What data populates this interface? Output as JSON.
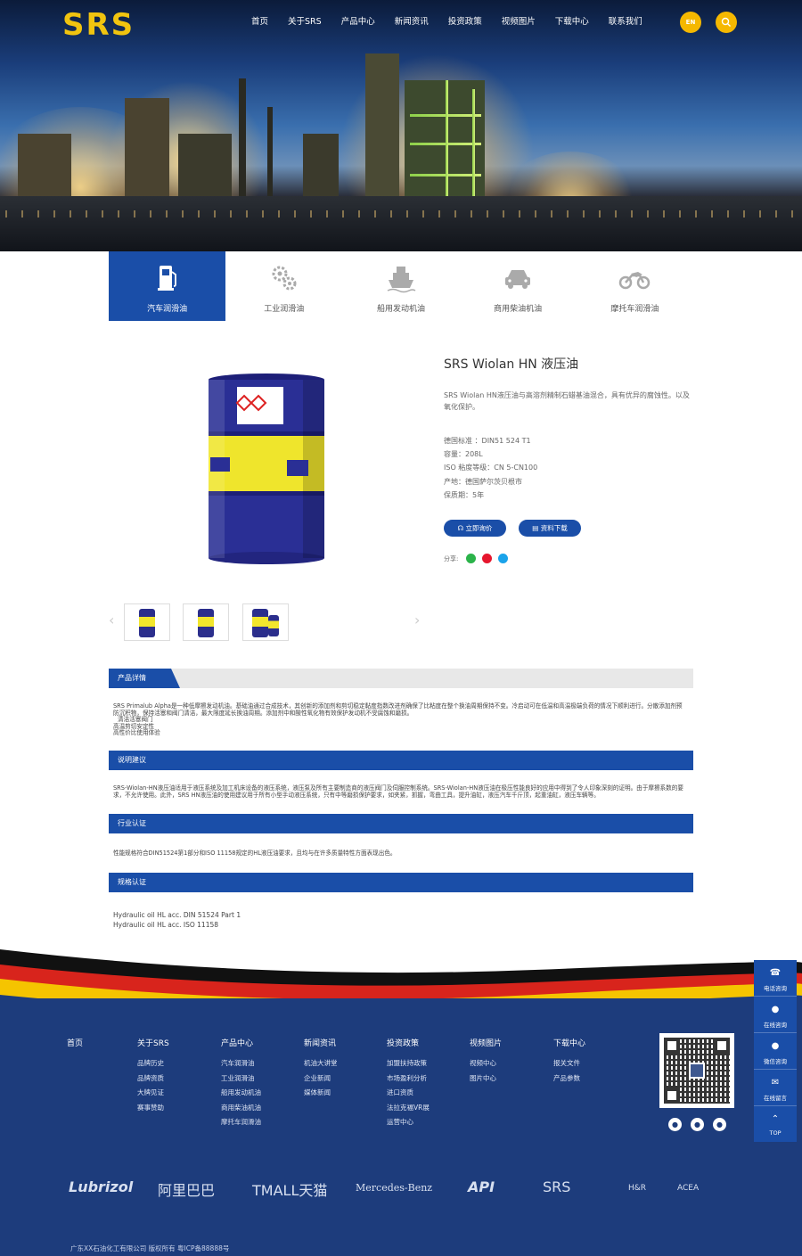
{
  "header": {
    "logo": "SRS",
    "nav": [
      "首页",
      "关于SRS",
      "产品中心",
      "新闻资讯",
      "投资政策",
      "视频图片",
      "下载中心",
      "联系我们"
    ],
    "lang_button": "EN",
    "search_icon": "search-icon"
  },
  "categories": [
    {
      "label": "汽车润滑油",
      "icon": "fuel-pump-icon",
      "active": true
    },
    {
      "label": "工业润滑油",
      "icon": "gears-icon",
      "active": false
    },
    {
      "label": "船用发动机油",
      "icon": "ship-icon",
      "active": false
    },
    {
      "label": "商用柴油机油",
      "icon": "car-icon",
      "active": false
    },
    {
      "label": "摩托车润滑油",
      "icon": "motorcycle-icon",
      "active": false
    }
  ],
  "product": {
    "title": "SRS Wiolan HN 液压油",
    "description": "SRS Wiolan HN液压油与高溶剂精制石蜡基油混合，具有优异的腐蚀性。以及氧化保护。",
    "specs": [
      "德国标准 ：DIN51 524 T1",
      "容量：208L",
      "ISO 粘度等级：CN 5-CN100",
      "产地：德国萨尔茨贝根市",
      "保质期：5年"
    ],
    "btn_inquiry": "立即询价",
    "btn_download": "资料下载",
    "share_label": "分享:"
  },
  "sections": {
    "detail": {
      "title": "产品详情",
      "lines": [
        "SRS Primalub Alpha是一种低摩擦发动机油。基础油通过合成技术，其创新的添加剂和剪切稳定黏度指数改进剂确保了比粘度在整个换油周期保持不变。冷启动可在低温和高温极端负荷的情况下顺利进行。分散添加剂预防沉积物，保持活塞和阀门清洁，最大限度延长换油周期。添加剂中和酸性氧化物有效保护发动机不受腐蚀和磨损。",
        "清洁活塞阀门",
        "高温剪切安定性",
        "高性价比使用体验"
      ]
    },
    "usage": {
      "title": "说明建议",
      "text": "SRS-Wiolan-HN液压油适用于液压系统及加工机床设备的液压系统，液压泵及所有主要制造商的液压阀门及伺服控制系统。SRS-Wiolan-HN液压油在极压性能良好的应用中得到了令人印象深刻的证明。由于摩擦系数的要求，不允许使用。此外，SRS HN液压油的使用建议用于所有小型手动液压系统，只有中等磨损保护要求，如夹紧，抓握，弯曲工具，提升油缸，液压汽车千斤顶，起重油缸，液压车辆等。"
    },
    "industry": {
      "title": "行业认证",
      "text": "性能规格符合DIN51524第1部分和ISO 11158规定的HL液压油要求，且均与在许多质量特性方面表现出色。"
    },
    "specs": {
      "title": "规格认证",
      "lines": [
        "Hydraulic oil HL acc. DIN 51524 Part 1",
        "Hydraulic oil HL acc. ISO 11158"
      ]
    }
  },
  "footer": {
    "columns": [
      {
        "heading": "首页",
        "items": []
      },
      {
        "heading": "关于SRS",
        "items": [
          "品牌历史",
          "品牌资质",
          "大牌见证",
          "赛事赞助"
        ]
      },
      {
        "heading": "产品中心",
        "items": [
          "汽车润滑油",
          "工业润滑油",
          "船用发动机油",
          "商用柴油机油",
          "摩托车润滑油"
        ]
      },
      {
        "heading": "新闻资讯",
        "items": [
          "机油大讲堂",
          "企业新闻",
          "媒体新闻"
        ]
      },
      {
        "heading": "投资政策",
        "items": [
          "加盟扶持政策",
          "市场盈利分析",
          "进口资质",
          "法拉克福VR展",
          "运营中心"
        ]
      },
      {
        "heading": "视频图片",
        "items": [
          "视频中心",
          "图片中心"
        ]
      },
      {
        "heading": "下载中心",
        "items": [
          "报关文件",
          "产品参数"
        ]
      }
    ],
    "partners": [
      "Lubrizol",
      "阿里巴巴",
      "TMALL天猫",
      "Mercedes-Benz",
      "API",
      "SRS",
      "H&R",
      "ACEA"
    ],
    "copyright": "广东XX石油化工有限公司 版权所有 粤ICP备88888号"
  },
  "sidebar": [
    {
      "label": "电话咨询",
      "icon": "phone-icon"
    },
    {
      "label": "在线咨询",
      "icon": "qq-icon"
    },
    {
      "label": "微信咨询",
      "icon": "wechat-icon"
    },
    {
      "label": "在线留言",
      "icon": "message-icon"
    },
    {
      "label": "TOP",
      "icon": "arrow-up-icon"
    }
  ],
  "colors": {
    "primary": "#1a4ea8",
    "accent": "#f5b800",
    "footer": "#1d3c7c"
  }
}
